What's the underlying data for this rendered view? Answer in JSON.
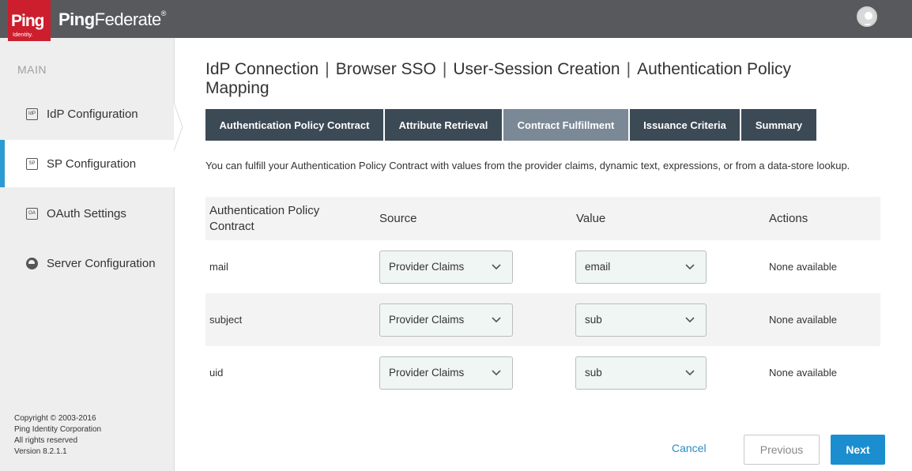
{
  "header": {
    "logo_text": "Ping",
    "logo_subtext": "Identity.",
    "brand_bold": "Ping",
    "brand_regular": "Federate",
    "brand_mark": "®",
    "user_icon": "user-avatar-icon"
  },
  "sidebar": {
    "heading": "MAIN",
    "items": [
      {
        "label": "IdP Configuration",
        "icon": "IdP",
        "active": false
      },
      {
        "label": "SP Configuration",
        "icon": "SP",
        "active": true
      },
      {
        "label": "OAuth Settings",
        "icon": "OA",
        "active": false
      },
      {
        "label": "Server Configuration",
        "icon": "server-config-icon",
        "active": false
      }
    ],
    "footer": {
      "line1": "Copyright © 2003-2016",
      "line2": "Ping Identity Corporation",
      "line3": "All rights reserved",
      "line4": "Version 8.2.1.1"
    }
  },
  "breadcrumb": {
    "part1": "IdP Connection",
    "part2": "Browser SSO",
    "part3": "User-Session Creation",
    "part4": "Authentication Policy Mapping",
    "separator": "|"
  },
  "tabs": [
    {
      "label": "Authentication Policy Contract",
      "active": false
    },
    {
      "label": "Attribute Retrieval",
      "active": false
    },
    {
      "label": "Contract Fulfillment",
      "active": true
    },
    {
      "label": "Issuance Criteria",
      "active": false
    },
    {
      "label": "Summary",
      "active": false
    }
  ],
  "description": "You can fulfill your Authentication Policy Contract with values from the provider claims, dynamic text, expressions, or from a data-store lookup.",
  "table": {
    "columns": [
      "Authentication Policy Contract",
      "Source",
      "Value",
      "Actions"
    ],
    "rows": [
      {
        "contract": "mail",
        "source": "Provider Claims",
        "value": "email",
        "actions": "None available"
      },
      {
        "contract": "subject",
        "source": "Provider Claims",
        "value": "sub",
        "actions": "None available"
      },
      {
        "contract": "uid",
        "source": "Provider Claims",
        "value": "sub",
        "actions": "None available"
      }
    ]
  },
  "footer_buttons": {
    "cancel": "Cancel",
    "previous": "Previous",
    "next": "Next"
  },
  "colors": {
    "topbar": "#57595d",
    "logo_red": "#cc1e2d",
    "tab_dark": "#3c4a56",
    "tab_active": "#7b8996",
    "accent_blue": "#1b8ed0",
    "active_marker": "#2c9ad3"
  }
}
